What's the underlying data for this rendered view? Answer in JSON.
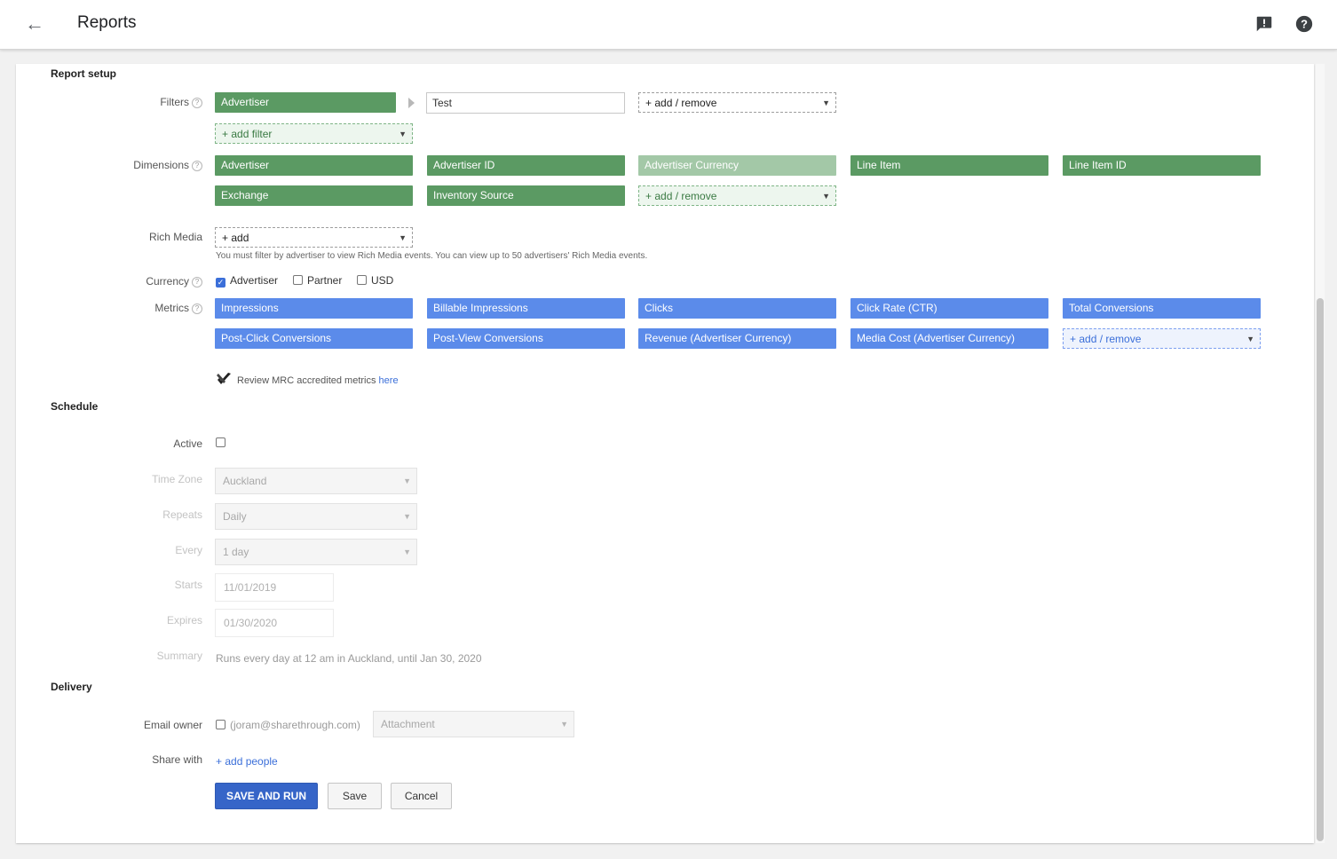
{
  "header": {
    "title": "Reports",
    "back_icon": "arrow-back-icon",
    "feedback_icon": "feedback-icon",
    "help_icon": "help-icon"
  },
  "report_setup": {
    "heading": "Report setup",
    "filters_label": "Filters",
    "filter_chip": "Advertiser",
    "filter_value": "Test",
    "filter_add_remove": "+ add / remove",
    "add_filter": "+ add filter",
    "dimensions_label": "Dimensions",
    "dimensions": [
      "Advertiser",
      "Advertiser ID",
      "Advertiser Currency",
      "Line Item",
      "Line Item ID",
      "Exchange",
      "Inventory Source"
    ],
    "dimensions_add_remove": "+ add / remove",
    "rich_media_label": "Rich Media",
    "rich_media_add": "+ add",
    "rich_media_note": "You must filter by advertiser to view Rich Media events. You can view up to 50 advertisers' Rich Media events.",
    "currency_label": "Currency",
    "currency_options": [
      "Advertiser",
      "Partner",
      "USD"
    ],
    "currency_selected": "Advertiser",
    "metrics_label": "Metrics",
    "metrics": [
      "Impressions",
      "Billable Impressions",
      "Clicks",
      "Click Rate (CTR)",
      "Total Conversions",
      "Post-Click Conversions",
      "Post-View Conversions",
      "Revenue (Advertiser Currency)",
      "Media Cost (Advertiser Currency)"
    ],
    "metrics_add_remove": "+ add / remove",
    "mrc_text": "Review MRC accredited metrics",
    "mrc_link": "here"
  },
  "schedule": {
    "heading": "Schedule",
    "active_label": "Active",
    "time_zone_label": "Time Zone",
    "time_zone": "Auckland",
    "repeats_label": "Repeats",
    "repeats": "Daily",
    "every_label": "Every",
    "every": "1 day",
    "starts_label": "Starts",
    "starts": "11/01/2019",
    "expires_label": "Expires",
    "expires": "01/30/2020",
    "summary_label": "Summary",
    "summary": "Runs every day at 12 am in Auckland, until Jan 30, 2020"
  },
  "delivery": {
    "heading": "Delivery",
    "email_owner_label": "Email owner",
    "email_owner": "(joram@sharethrough.com)",
    "attachment": "Attachment",
    "share_with_label": "Share with",
    "add_people": "+ add people"
  },
  "actions": {
    "save_and_run": "SAVE AND RUN",
    "save": "Save",
    "cancel": "Cancel"
  },
  "colors": {
    "dimension_chip": "#5b9a63",
    "metric_chip": "#5b8bea",
    "primary_button": "#3665c8"
  }
}
